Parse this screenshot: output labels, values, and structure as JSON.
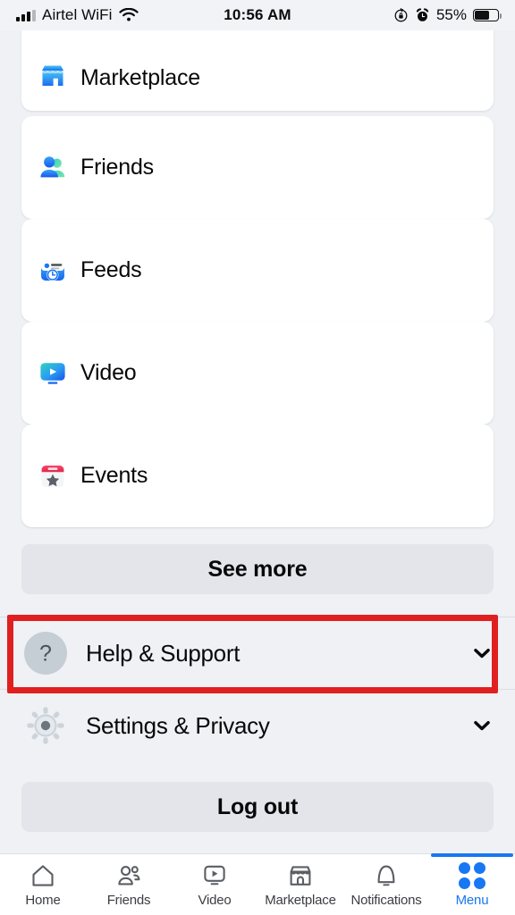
{
  "status_bar": {
    "carrier": "Airtel WiFi",
    "signal_icon": "signal-bars-icon",
    "wifi_icon": "wifi-icon",
    "time": "10:56 AM",
    "rotation_lock_icon": "rotation-lock-icon",
    "alarm_icon": "alarm-clock-icon",
    "battery_percent": "55%",
    "battery_icon": "battery-icon"
  },
  "menu": {
    "shortcuts": [
      {
        "label": "Marketplace",
        "icon": "marketplace-storefront-icon"
      },
      {
        "label": "Friends",
        "icon": "friends-people-icon"
      },
      {
        "label": "Feeds",
        "icon": "feeds-clock-icon"
      },
      {
        "label": "Video",
        "icon": "video-play-icon"
      },
      {
        "label": "Events",
        "icon": "events-calendar-star-icon"
      }
    ],
    "see_more_label": "See more",
    "expandables": [
      {
        "label": "Help & Support",
        "icon": "question-mark-circle-icon",
        "chevron": "chevron-down-icon",
        "highlighted": true
      },
      {
        "label": "Settings & Privacy",
        "icon": "gear-icon",
        "chevron": "chevron-down-icon",
        "highlighted": false
      }
    ],
    "log_out_label": "Log out"
  },
  "annotation": {
    "color": "#e02020",
    "target": "Help & Support"
  },
  "tab_bar": {
    "tabs": [
      {
        "label": "Home",
        "icon": "home-icon",
        "active": false
      },
      {
        "label": "Friends",
        "icon": "friends-icon",
        "active": false
      },
      {
        "label": "Video",
        "icon": "video-icon",
        "active": false
      },
      {
        "label": "Marketplace",
        "icon": "marketplace-icon",
        "active": false
      },
      {
        "label": "Notifications",
        "icon": "bell-icon",
        "active": false
      },
      {
        "label": "Menu",
        "icon": "menu-grid-icon",
        "active": true
      }
    ],
    "accent_color": "#1877f2"
  }
}
